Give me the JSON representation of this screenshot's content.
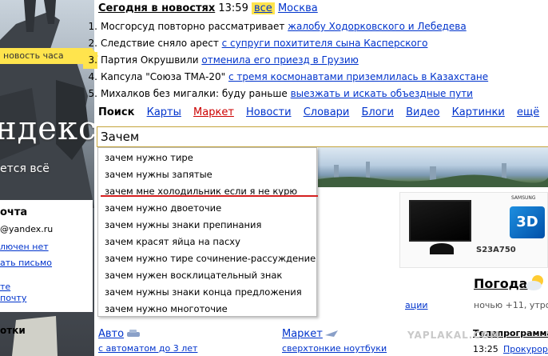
{
  "colors": {
    "link": "#0033cc",
    "highlight": "#ffe44d",
    "market": "#cc0000",
    "underline": "#d42020"
  },
  "logo": {
    "text": "ндекс",
    "tagline": "ется всё"
  },
  "news": {
    "heading": "Сегодня в новостях",
    "time": "13:59",
    "all": "все",
    "city": "Москва",
    "hour_label": "новость часа",
    "items": [
      {
        "num": "1.",
        "text": "Мосгорсуд повторно рассматривает ",
        "link": "жалобу Ходорковского и Лебедева"
      },
      {
        "num": "2.",
        "text": "Следствие сняло арест ",
        "link": "с супруги похитителя сына Касперского"
      },
      {
        "num": "3.",
        "text": "Партия Окрушвили ",
        "link": "отменила его приезд в Грузию"
      },
      {
        "num": "4.",
        "text": "Капсула \"Союза ТМА-20\" ",
        "link": "с тремя космонавтами приземлилась в Казахстане"
      },
      {
        "num": "5.",
        "text": "Михалков без мигалки: буду раньше ",
        "link": "выезжать и искать объездные пути"
      }
    ]
  },
  "tabs": [
    {
      "label": "Поиск",
      "current": true
    },
    {
      "label": "Карты"
    },
    {
      "label": "Маркет",
      "market": true
    },
    {
      "label": "Новости"
    },
    {
      "label": "Словари"
    },
    {
      "label": "Блоги"
    },
    {
      "label": "Видео"
    },
    {
      "label": "Картинки"
    },
    {
      "label": "ещё"
    }
  ],
  "search": {
    "value": "Зачем"
  },
  "suggestions": [
    "зачем нужно тире",
    "зачем нужны запятые",
    "зачем мне холодильник если я не курю",
    "зачем нужно двоеточие",
    "зачем нужны знаки препинания",
    "зачем красят яйца на пасху",
    "зачем нужно тире сочинение-рассуждение",
    "зачем нужен восклицательный знак",
    "зачем нужны знаки конца предложения",
    "зачем нужно многоточие"
  ],
  "mail": {
    "title": "очта",
    "address": "@yandex.ru",
    "line1": "лючен нет",
    "line2": "ать письмо",
    "line3": "те",
    "line4": "почту"
  },
  "ad": {
    "brand": "SAMSUNG",
    "badge": "3D",
    "model": "S23A750"
  },
  "weather": {
    "title": "Погода",
    "temp": "ночью +11, утром +"
  },
  "fragment": "ации",
  "bottom": {
    "left": "отки",
    "auto": "Авто",
    "auto_sub": "с автоматом до 3 лет",
    "market": "Маркет",
    "market_sub": "сверхтонкие ноутбуки",
    "tv": "Телепрограмма",
    "time": "13:25",
    "prog": "Прокурор"
  },
  "watermark": "YAPLAKAL.COM"
}
